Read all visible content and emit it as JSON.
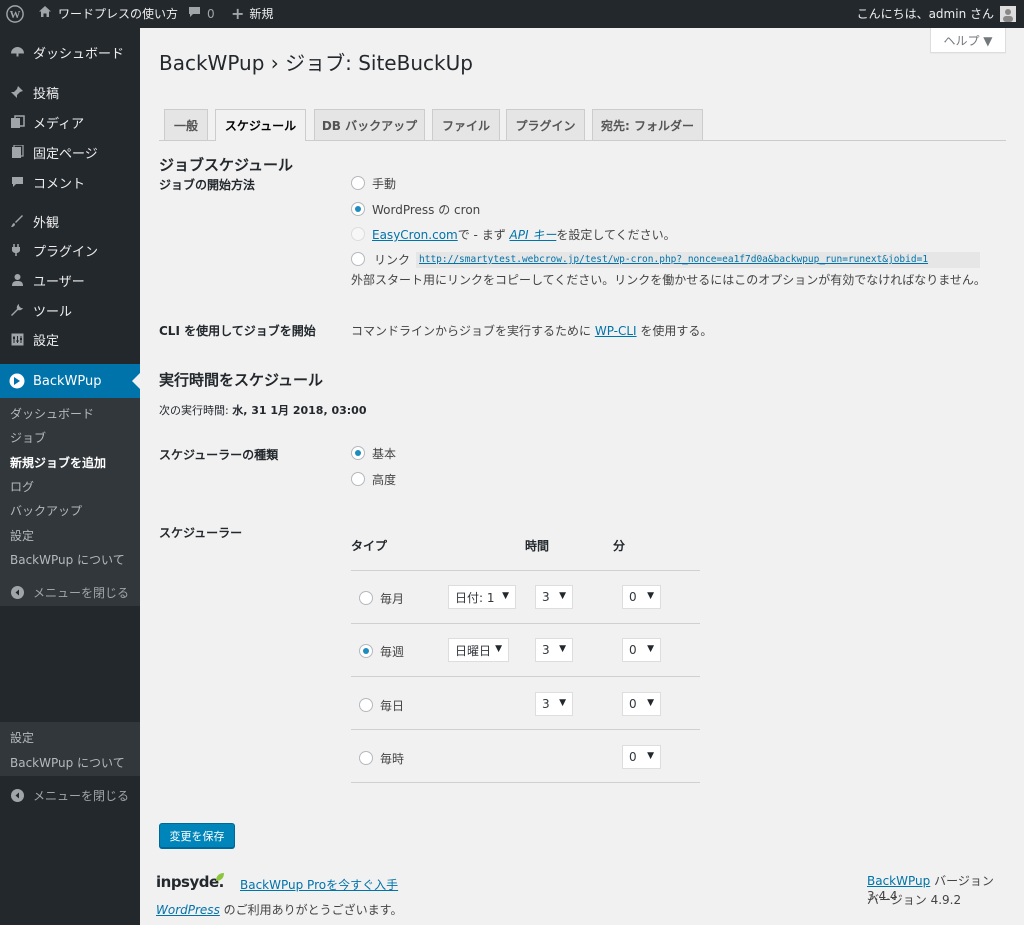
{
  "adminbar": {
    "site_name": "ワードプレスの使い方",
    "comments_count": "0",
    "new_label": "新規",
    "greeting": "こんにちは、admin さん"
  },
  "sidebar": {
    "items": [
      {
        "label": "ダッシュボード",
        "icon": "dashboard-icon"
      },
      {
        "label": "投稿",
        "icon": "pin-icon"
      },
      {
        "label": "メディア",
        "icon": "media-icon"
      },
      {
        "label": "固定ページ",
        "icon": "page-icon"
      },
      {
        "label": "コメント",
        "icon": "comment-icon"
      },
      {
        "label": "外観",
        "icon": "brush-icon"
      },
      {
        "label": "プラグイン",
        "icon": "plugin-icon"
      },
      {
        "label": "ユーザー",
        "icon": "user-icon"
      },
      {
        "label": "ツール",
        "icon": "wrench-icon"
      },
      {
        "label": "設定",
        "icon": "settings-icon"
      }
    ],
    "backwpup_label": "BackWPup",
    "submenu": [
      "ダッシュボード",
      "ジョブ",
      "新規ジョブを追加",
      "ログ",
      "バックアップ",
      "設定",
      "BackWPup について"
    ],
    "collapse_label": "メニューを閉じる",
    "lower_submenu": [
      "設定",
      "BackWPup について"
    ],
    "lower_collapse_label": "メニューを閉じる"
  },
  "help_button": "ヘルプ ▼",
  "page_title": "BackWPup › ジョブ: SiteBuckUp",
  "tabs": [
    "一般",
    "スケジュール",
    "DB バックアップ",
    "ファイル",
    "プラグイン",
    "宛先: フォルダー"
  ],
  "section1_title": "ジョブスケジュール",
  "start_method": {
    "label": "ジョブの開始方法",
    "manual": "手動",
    "cron": "WordPress の cron",
    "easycron_link": "EasyCron.com",
    "easycron_mid": "で - まず ",
    "api_link": "API キー",
    "easycron_end": "を設定してください。",
    "link_label": "リンク",
    "link_url": "http://smartytest.webcrow.jp/test/wp-cron.php?_nonce=ea1f7d0a&backwpup_run=runext&jobid=1",
    "link_desc": "外部スタート用にリンクをコピーしてください。リンクを働かせるにはこのオプションが有効でなければなりません。"
  },
  "cli": {
    "label": "CLI を使用してジョブを開始",
    "text_before": "コマンドラインからジョブを実行するために ",
    "link": "WP-CLI",
    "text_after": " を使用する。"
  },
  "section2_title": "実行時間をスケジュール",
  "next_run": {
    "label": "次の実行時間: ",
    "value": "水, 31 1月 2018, 03:00"
  },
  "scheduler_type": {
    "label": "スケジューラーの種類",
    "basic": "基本",
    "advanced": "高度"
  },
  "scheduler": {
    "label": "スケジューラー",
    "col_type": "タイプ",
    "col_hour": "時間",
    "col_minute": "分",
    "rows": [
      {
        "type": "毎月",
        "day": "日付: 1",
        "hour": "3",
        "minute": "0"
      },
      {
        "type": "毎週",
        "day": "日曜日",
        "hour": "3",
        "minute": "0"
      },
      {
        "type": "毎日",
        "day": "",
        "hour": "3",
        "minute": "0"
      },
      {
        "type": "毎時",
        "day": "",
        "hour": "",
        "minute": "0"
      }
    ]
  },
  "save_button": "変更を保存",
  "footer": {
    "brand": "inpsyde.",
    "pro_link": "BackWPup Proを今すぐ入手",
    "wp_link": "WordPress",
    "thanks": " のご利用ありがとうございます。",
    "backwpup_link": "BackWPup",
    "backwpup_version": " バージョン 3.4.4",
    "wp_version": "バージョン 4.9.2"
  },
  "colors": {
    "accent": "#0073aa",
    "sidebar": "#23282d",
    "active_menu": "#0073aa",
    "button": "#0085ba"
  }
}
